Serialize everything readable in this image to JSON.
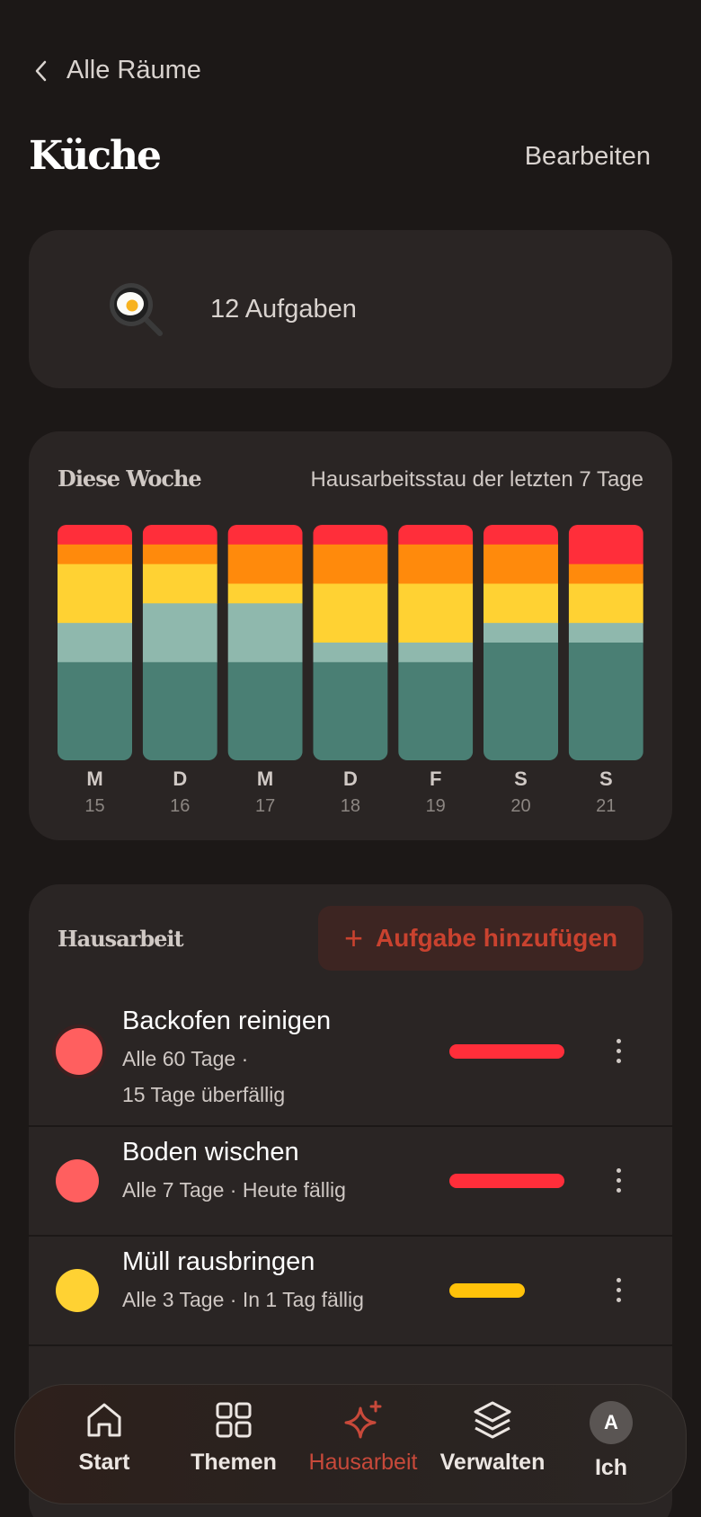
{
  "nav": {
    "back_label": "Alle Räume",
    "edit_label": "Bearbeiten"
  },
  "room": {
    "title": "Küche",
    "icon": "frying-pan-egg-emoji",
    "task_count": "12 Aufgaben"
  },
  "week": {
    "title": "Diese Woche",
    "subtitle": "Hausarbeitsstau der letzten 7 Tage",
    "colors": {
      "red": "#ff2e3a",
      "orange": "#ff8a0c",
      "yellow": "#ffd233",
      "lightteal": "#8fb8ad",
      "darkteal": "#4a7f74"
    },
    "days": [
      {
        "letter": "M",
        "num": "15"
      },
      {
        "letter": "D",
        "num": "16"
      },
      {
        "letter": "M",
        "num": "17"
      },
      {
        "letter": "D",
        "num": "18"
      },
      {
        "letter": "F",
        "num": "19"
      },
      {
        "letter": "S",
        "num": "20"
      },
      {
        "letter": "S",
        "num": "21"
      }
    ],
    "chart_data": {
      "type": "bar",
      "stacked": true,
      "categories": [
        "M 15",
        "D 16",
        "M 17",
        "D 18",
        "F 19",
        "S 20",
        "S 21"
      ],
      "series": [
        {
          "values": [
            5,
            5,
            5,
            5,
            5,
            5,
            10
          ]
        },
        {
          "values": [
            5,
            5,
            10,
            10,
            10,
            10,
            5
          ]
        },
        {
          "values": [
            15,
            10,
            5,
            15,
            15,
            10,
            10
          ]
        },
        {
          "values": [
            10,
            15,
            15,
            5,
            5,
            5,
            5
          ]
        },
        {
          "values": [
            25,
            25,
            25,
            25,
            25,
            30,
            30
          ]
        }
      ]
    }
  },
  "chores": {
    "title": "Hausarbeit",
    "add_label": "Aufgabe hinzufügen",
    "items": [
      {
        "name": "Backofen reinigen",
        "meta1": "Alle 60 Tage ·",
        "meta2": "15 Tage überfällig",
        "dot_color": "#ff5f5f",
        "bar_color": "#ff2e3a",
        "bar_level": 1.0
      },
      {
        "name": "Boden wischen",
        "meta1": "Alle 7 Tage · Heute fällig",
        "meta2": "",
        "dot_color": "#ff5f5f",
        "bar_color": "#ff2e3a",
        "bar_level": 1.0
      },
      {
        "name": "Müll rausbringen",
        "meta1": "Alle 3 Tage · In 1 Tag fällig",
        "meta2": "",
        "dot_color": "#ffd233",
        "bar_color": "#ffc20a",
        "bar_level": 0.66
      }
    ]
  },
  "tabs": [
    {
      "label": "Start",
      "icon": "home-icon"
    },
    {
      "label": "Themen",
      "icon": "grid-icon"
    },
    {
      "label": "Hausarbeit",
      "icon": "sparkle-icon"
    },
    {
      "label": "Verwalten",
      "icon": "layers-icon"
    },
    {
      "label": "Ich",
      "icon": "avatar",
      "initial": "A"
    }
  ]
}
